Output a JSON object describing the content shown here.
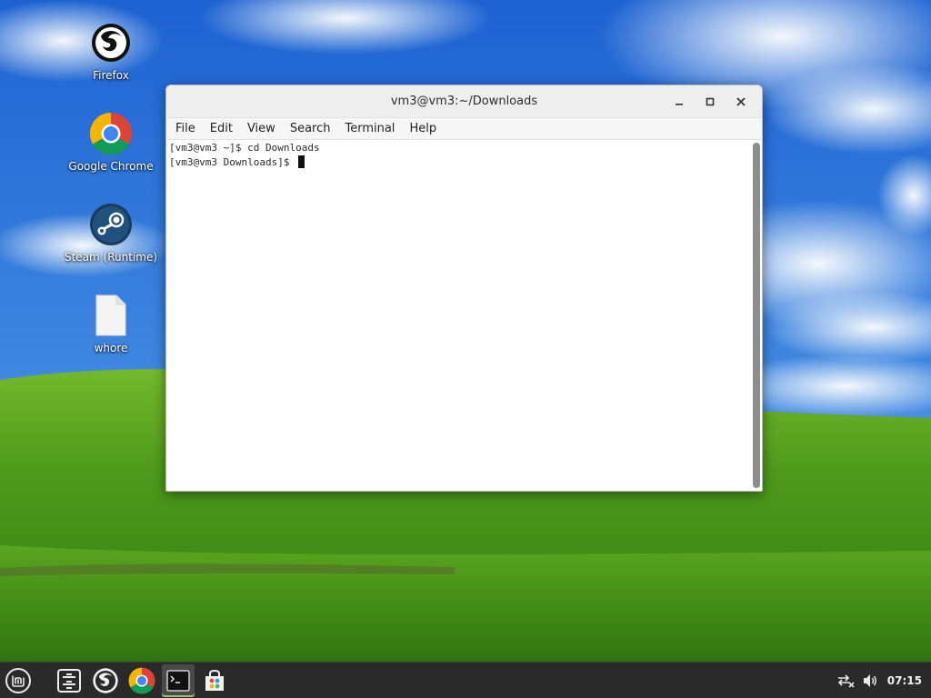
{
  "desktop": {
    "icons": [
      {
        "label": "Firefox",
        "icon": "firefox-icon"
      },
      {
        "label": "Google Chrome",
        "icon": "chrome-icon"
      },
      {
        "label": "Steam (Runtime)",
        "icon": "steam-icon"
      },
      {
        "label": "whore",
        "icon": "file-icon"
      }
    ]
  },
  "terminal": {
    "title": "vm3@vm3:~/Downloads",
    "menu": [
      "File",
      "Edit",
      "View",
      "Search",
      "Terminal",
      "Help"
    ],
    "lines": [
      "[vm3@vm3 ~]$ cd Downloads",
      "[vm3@vm3 Downloads]$ "
    ],
    "controls": [
      "minimize-icon",
      "maximize-icon",
      "close-icon"
    ]
  },
  "taskbar": {
    "items": [
      "mint-menu-icon",
      "file-manager-icon",
      "firefox-icon",
      "chrome-icon",
      "terminal-icon",
      "software-manager-icon"
    ],
    "active": "terminal-icon",
    "tray": [
      "network-disconnected-icon",
      "volume-icon"
    ],
    "clock": "07:15"
  },
  "colors": {
    "taskbar_bg": "#2a2a2a",
    "accent": "#9dc26a",
    "sky": "#2f6fd0",
    "grass": "#4a9a1a"
  }
}
